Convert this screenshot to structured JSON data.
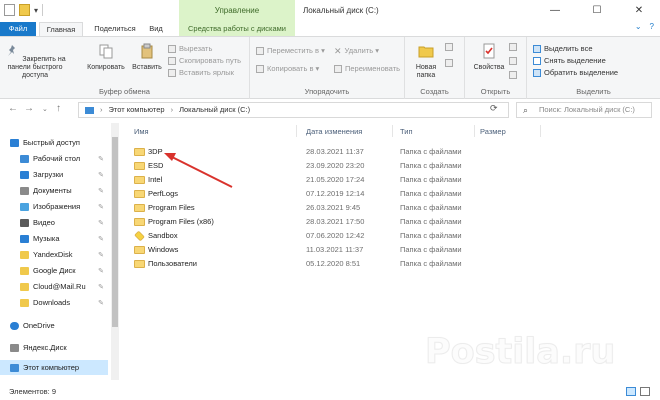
{
  "titlebar": {
    "manage_label": "Управление",
    "window_title": "Локальный диск (C:)",
    "minimize": "—",
    "maximize": "☐",
    "close": "✕"
  },
  "tabs": {
    "file": "Файл",
    "home": "Главная",
    "share": "Поделиться",
    "view": "Вид",
    "disk_tools": "Средства работы с дисками"
  },
  "ribbon": {
    "clipboard": {
      "pin_label": "Закрепить на панели быстрого доступа",
      "copy_label": "Копировать",
      "paste_label": "Вставить",
      "cut_label": "Вырезать",
      "copy_path_label": "Скопировать путь",
      "paste_shortcut_label": "Вставить ярлык",
      "group_label": "Буфер обмена"
    },
    "organize": {
      "move_label": "Переместить в ▾",
      "delete_label": "Удалить ▾",
      "copy_to_label": "Копировать в ▾",
      "rename_label": "Переименовать",
      "group_label": "Упорядочить"
    },
    "create": {
      "new_folder_label": "Новая папка",
      "group_label": "Создать"
    },
    "open": {
      "properties_label": "Свойства",
      "group_label": "Открыть"
    },
    "select": {
      "select_all_label": "Выделить все",
      "select_none_label": "Снять выделение",
      "invert_label": "Обратить выделение",
      "group_label": "Выделить"
    }
  },
  "address": {
    "path": [
      "Этот компьютер",
      "Локальный диск (C:)"
    ],
    "search_placeholder": "Поиск: Локальный диск (C:)"
  },
  "sidebar": {
    "items": [
      {
        "label": "Быстрый доступ",
        "icon": "star-icon",
        "color": "#2a7fd4",
        "pinned": false
      },
      {
        "label": "Рабочий стол",
        "icon": "desktop-icon",
        "color": "#3c8bd6",
        "pinned": true
      },
      {
        "label": "Загрузки",
        "icon": "download-icon",
        "color": "#2a7fd4",
        "pinned": true
      },
      {
        "label": "Документы",
        "icon": "documents-icon",
        "color": "#8a8a8a",
        "pinned": true
      },
      {
        "label": "Изображения",
        "icon": "pictures-icon",
        "color": "#4aa3e0",
        "pinned": true
      },
      {
        "label": "Видео",
        "icon": "video-icon",
        "color": "#5a5a5a",
        "pinned": true
      },
      {
        "label": "Музыка",
        "icon": "music-icon",
        "color": "#2a7fd4",
        "pinned": true
      },
      {
        "label": "YandexDisk",
        "icon": "folder-icon",
        "color": "#f0c94c",
        "pinned": true
      },
      {
        "label": "Google Диск",
        "icon": "google-drive-icon",
        "color": "#f0c94c",
        "pinned": true
      },
      {
        "label": "Cloud@Mail.Ru",
        "icon": "folder-icon",
        "color": "#f0c94c",
        "pinned": true
      },
      {
        "label": "Downloads",
        "icon": "folder-icon",
        "color": "#f0c94c",
        "pinned": true
      },
      {
        "label": "OneDrive",
        "icon": "onedrive-icon",
        "color": "#2a7fd4",
        "pinned": false
      },
      {
        "label": "Яндекс.Диск",
        "icon": "yandex-disk-icon",
        "color": "#8a8a8a",
        "pinned": false
      },
      {
        "label": "Этот компьютер",
        "icon": "computer-icon",
        "color": "#3c8bd6",
        "pinned": false
      }
    ]
  },
  "list": {
    "headers": {
      "name": "Имя",
      "date": "Дата изменения",
      "type": "Тип",
      "size": "Размер"
    },
    "rows": [
      {
        "name": "3DP",
        "date": "28.03.2021 11:37",
        "type": "Папка с файлами"
      },
      {
        "name": "ESD",
        "date": "23.09.2020 23:20",
        "type": "Папка с файлами"
      },
      {
        "name": "Intel",
        "date": "21.05.2020 17:24",
        "type": "Папка с файлами"
      },
      {
        "name": "PerfLogs",
        "date": "07.12.2019 12:14",
        "type": "Папка с файлами"
      },
      {
        "name": "Program Files",
        "date": "26.03.2021 9:45",
        "type": "Папка с файлами"
      },
      {
        "name": "Program Files (x86)",
        "date": "28.03.2021 17:50",
        "type": "Папка с файлами"
      },
      {
        "name": "Sandbox",
        "date": "07.06.2020 12:42",
        "type": "Папка с файлами"
      },
      {
        "name": "Windows",
        "date": "11.03.2021 11:37",
        "type": "Папка с файлами"
      },
      {
        "name": "Пользователи",
        "date": "05.12.2020 8:51",
        "type": "Папка с файлами"
      }
    ]
  },
  "status": {
    "count": "Элементов: 9"
  },
  "watermark": "Postila.ru",
  "colors": {
    "accent": "#1979ca",
    "manage_tab": "#dcf3c9",
    "folder": "#f8d775",
    "arrow": "#d9322c",
    "selected": "#cce8ff"
  }
}
